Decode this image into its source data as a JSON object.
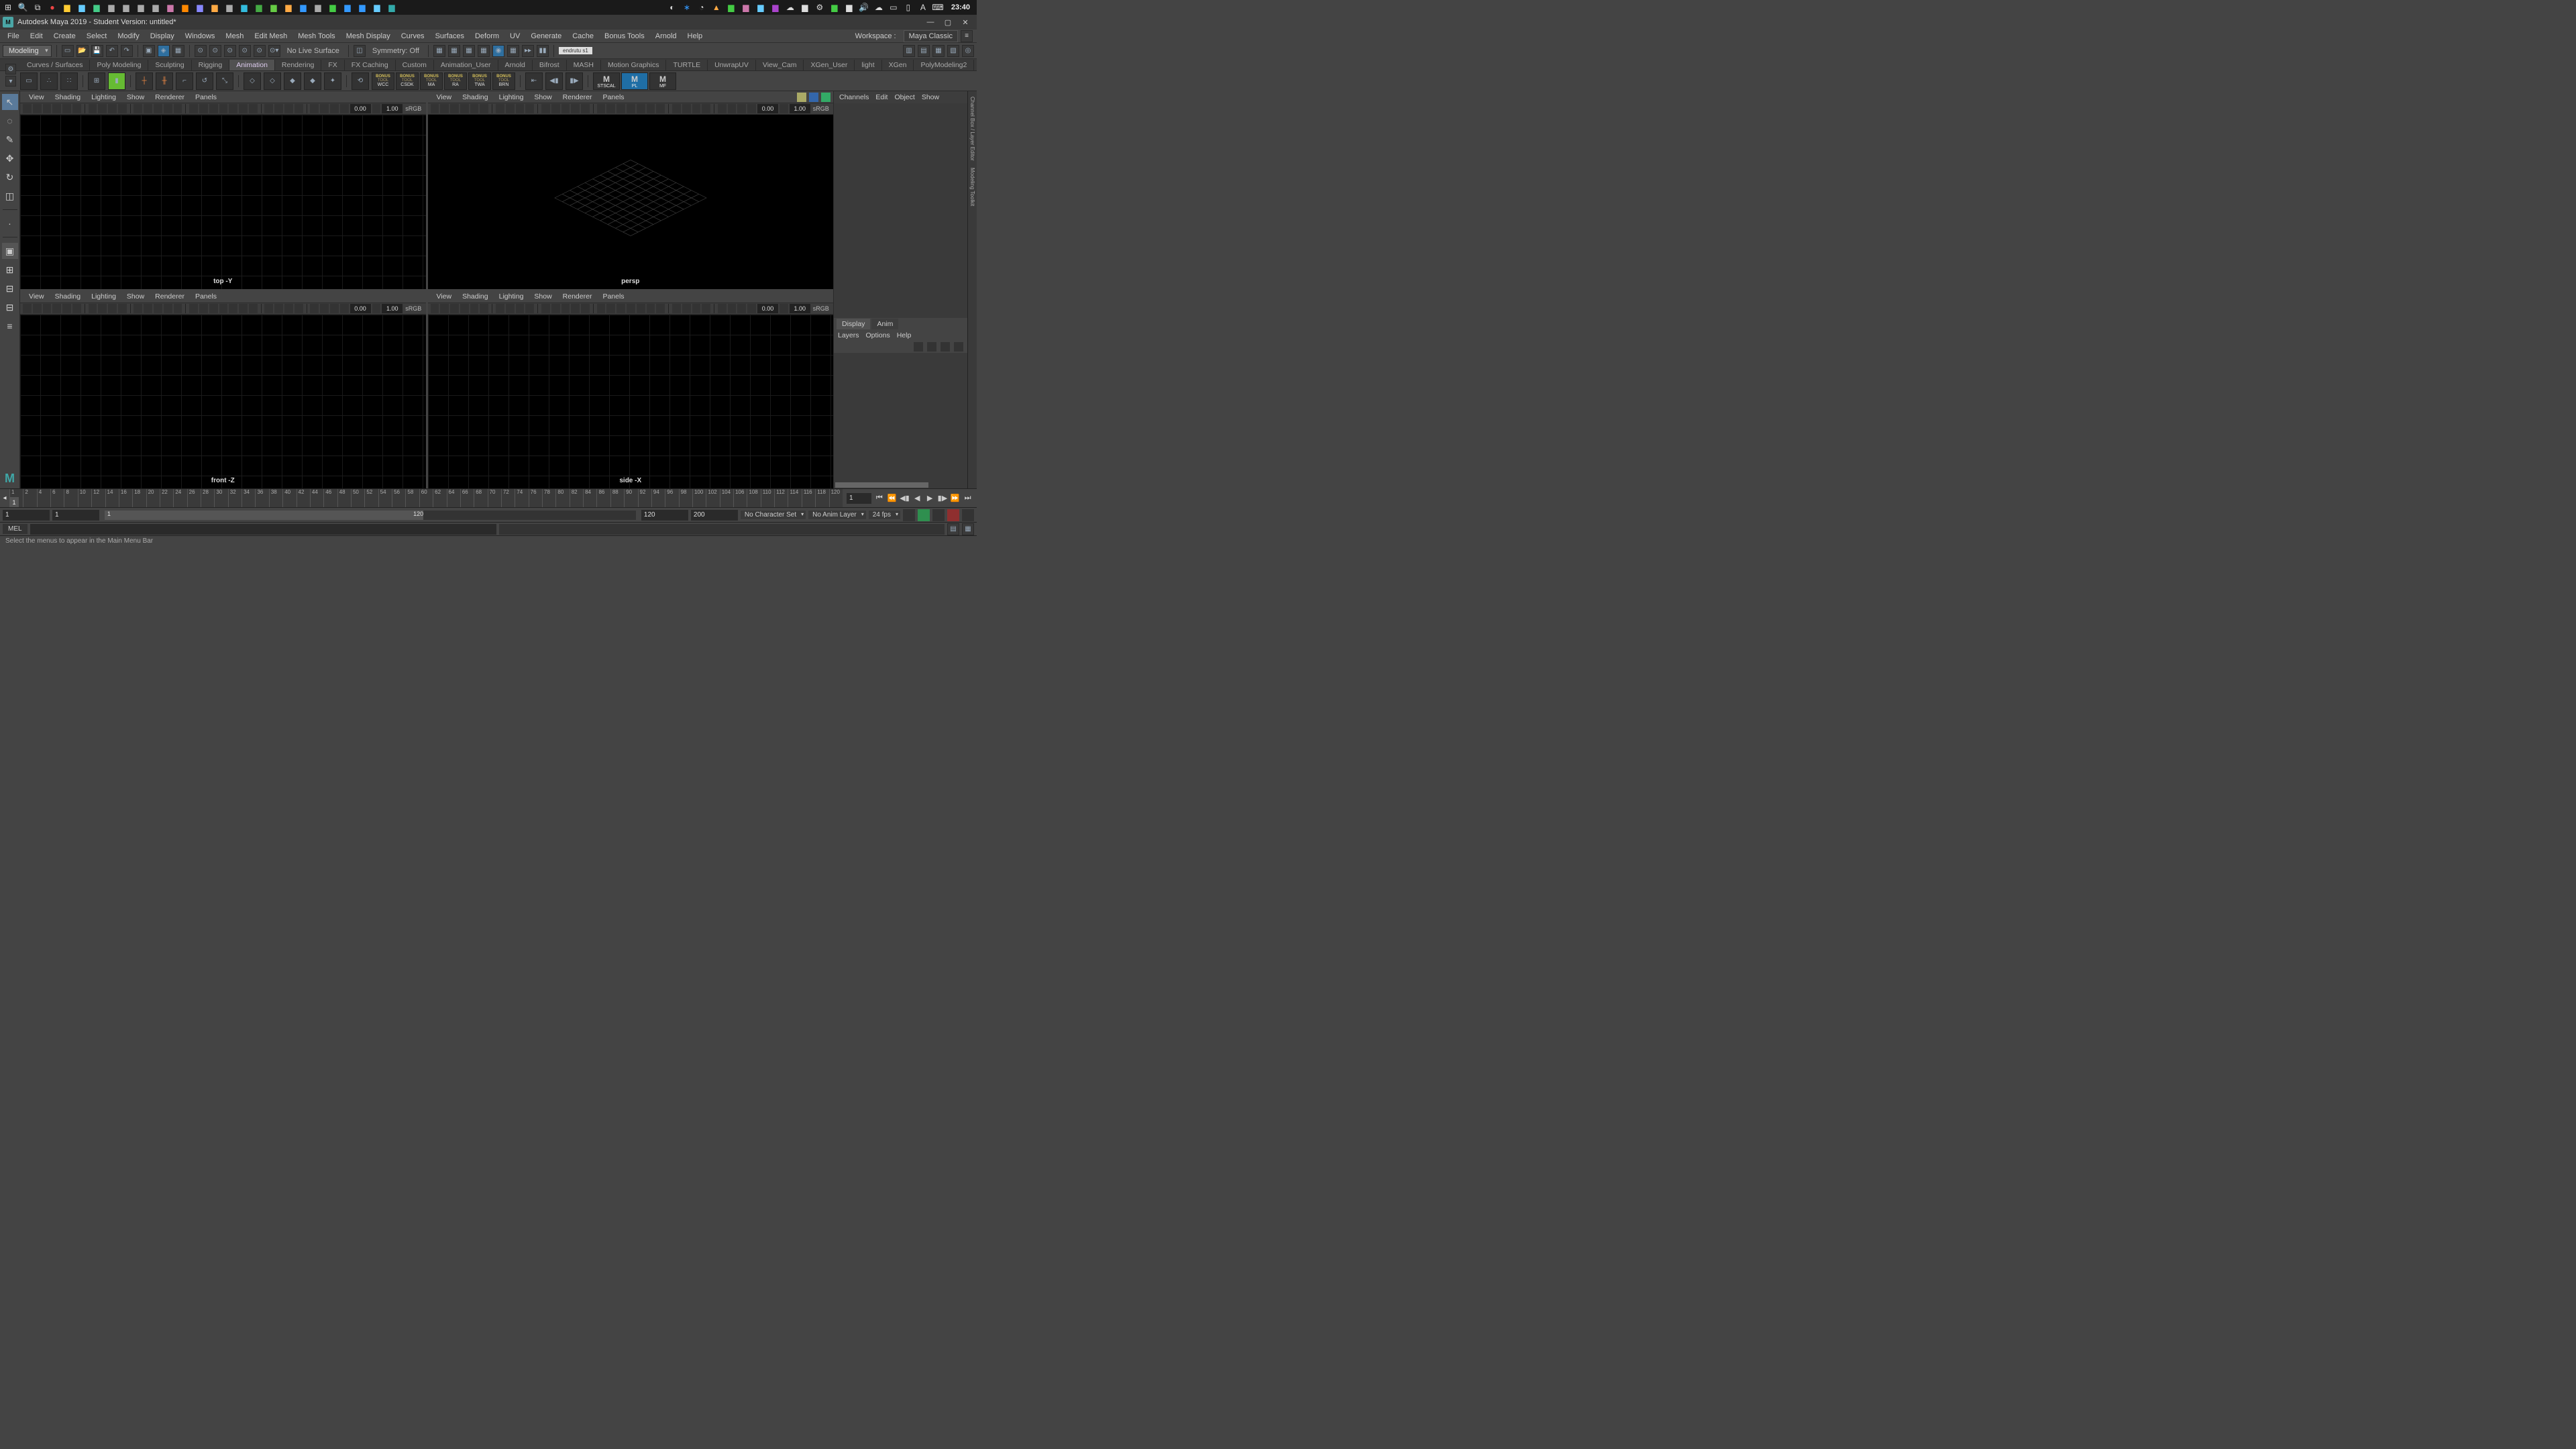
{
  "taskbar": {
    "clock": "23:40"
  },
  "titlebar": {
    "text": "Autodesk Maya 2019 - Student Version: untitled*"
  },
  "mainmenu": {
    "items": [
      "File",
      "Edit",
      "Create",
      "Select",
      "Modify",
      "Display",
      "Windows",
      "Mesh",
      "Edit Mesh",
      "Mesh Tools",
      "Mesh Display",
      "Curves",
      "Surfaces",
      "Deform",
      "UV",
      "Generate",
      "Cache",
      "Bonus Tools",
      "Arnold",
      "Help"
    ],
    "workspace_label": "Workspace :",
    "workspace_value": "Maya Classic"
  },
  "statusline": {
    "menuset": "Modeling",
    "live_surface": "No Live Surface",
    "symmetry": "Symmetry: Off",
    "render_chip": "endrutu s1"
  },
  "shelftabs": [
    "Curves / Surfaces",
    "Poly Modeling",
    "Sculpting",
    "Rigging",
    "Animation",
    "Rendering",
    "FX",
    "FX Caching",
    "Custom",
    "Animation_User",
    "Arnold",
    "Bifrost",
    "MASH",
    "Motion Graphics",
    "TURTLE",
    "UnwrapUV",
    "View_Cam",
    "XGen_User",
    "light",
    "XGen",
    "PolyModeling2"
  ],
  "shelftabs_active": 4,
  "shelf_bonus": [
    "WCC",
    "CSDK",
    "MA",
    "RA",
    "TWA",
    "BRN"
  ],
  "shelf_scale": [
    "STSCAL",
    "PL",
    "MF"
  ],
  "shelf_scale_active": 1,
  "viewport_menu": [
    "View",
    "Shading",
    "Lighting",
    "Show",
    "Renderer",
    "Panels"
  ],
  "viewport_nums": {
    "a": "0.00",
    "b": "1.00",
    "cs": "sRGB"
  },
  "vp_labels": {
    "tl": "top -Y",
    "tr": "persp",
    "bl": "front -Z",
    "br": "side -X"
  },
  "channelbox": {
    "menu": [
      "Channels",
      "Edit",
      "Object",
      "Show"
    ],
    "tabs": [
      "Display",
      "Anim"
    ],
    "tabs_active": 0,
    "submenu": [
      "Layers",
      "Options",
      "Help"
    ]
  },
  "timeline": {
    "current": "1",
    "ticks": [
      1,
      2,
      4,
      6,
      8,
      10,
      12,
      14,
      16,
      18,
      20,
      22,
      24,
      26,
      28,
      30,
      32,
      34,
      36,
      38,
      40,
      42,
      44,
      46,
      48,
      50,
      52,
      54,
      56,
      58,
      60,
      62,
      64,
      66,
      68,
      70,
      72,
      74,
      76,
      78,
      80,
      82,
      84,
      86,
      88,
      90,
      92,
      94,
      96,
      98,
      100,
      102,
      104,
      106,
      108,
      110,
      112,
      114,
      116,
      118,
      120
    ],
    "end_field": "1"
  },
  "range": {
    "start_outer": "1",
    "start_inner": "1",
    "slider_start": "1",
    "slider_end": "120",
    "end_inner": "120",
    "end_outer": "200",
    "charset": "No Character Set",
    "animlayer": "No Anim Layer",
    "fps": "24 fps"
  },
  "cmd": {
    "lang": "MEL"
  },
  "helpline": {
    "text": "Select the menus to appear in the Main Menu Bar"
  }
}
